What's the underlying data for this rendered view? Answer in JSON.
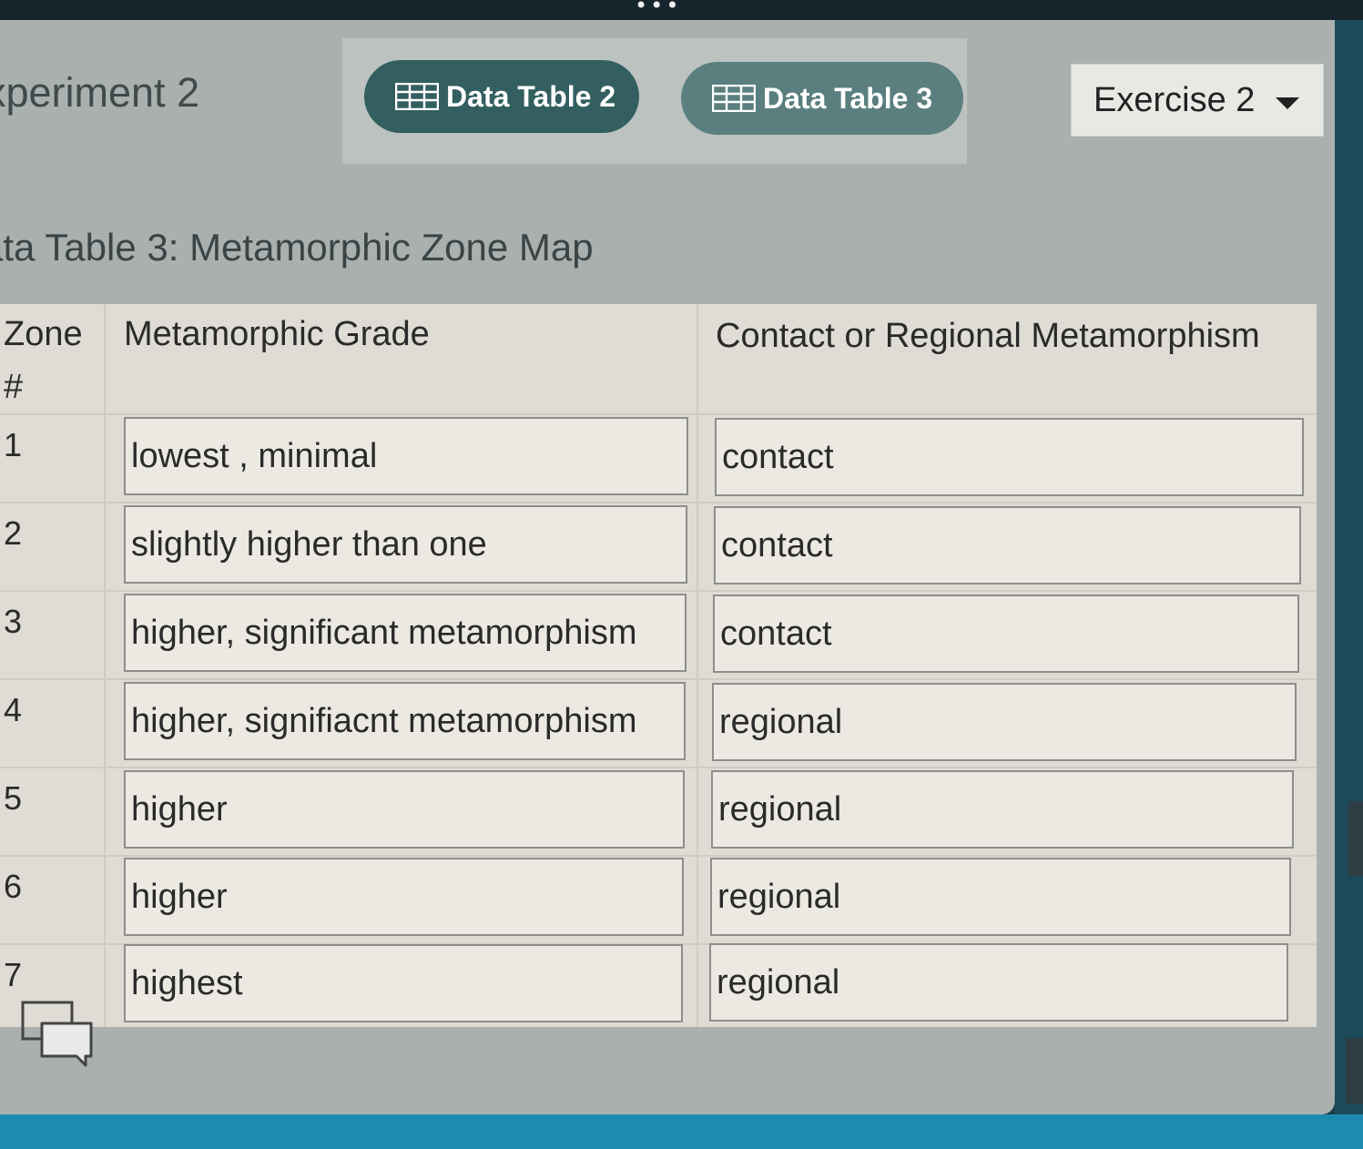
{
  "header": {
    "experiment_title": "xperiment 2",
    "tabs": [
      {
        "label": "Data Table 2",
        "icon": "table-grid-icon"
      },
      {
        "label": "Data Table 3",
        "icon": "table-grid-icon"
      }
    ],
    "exercise_select": "Exercise 2"
  },
  "table": {
    "title": "ata Table 3: Metamorphic Zone Map",
    "columns": [
      "Zone #",
      "Metamorphic Grade",
      "Contact or Regional Metamorphism"
    ],
    "rows": [
      {
        "zone": "1",
        "grade": "lowest , minimal",
        "type": "contact"
      },
      {
        "zone": "2",
        "grade": "slightly higher than one",
        "type": "contact"
      },
      {
        "zone": "3",
        "grade": "higher, significant metamorphism",
        "type": "contact"
      },
      {
        "zone": "4",
        "grade": "higher,  signifiacnt metamorphism",
        "type": "regional"
      },
      {
        "zone": "5",
        "grade": "higher",
        "type": "regional"
      },
      {
        "zone": "6",
        "grade": "higher",
        "type": "regional"
      },
      {
        "zone": "7",
        "grade": "highest",
        "type": "regional"
      }
    ]
  },
  "colors": {
    "tab_active": "#335f61",
    "tab_inactive": "#5a7f7e",
    "panel": "#aab0ae",
    "table_bg": "#dedcd4"
  }
}
